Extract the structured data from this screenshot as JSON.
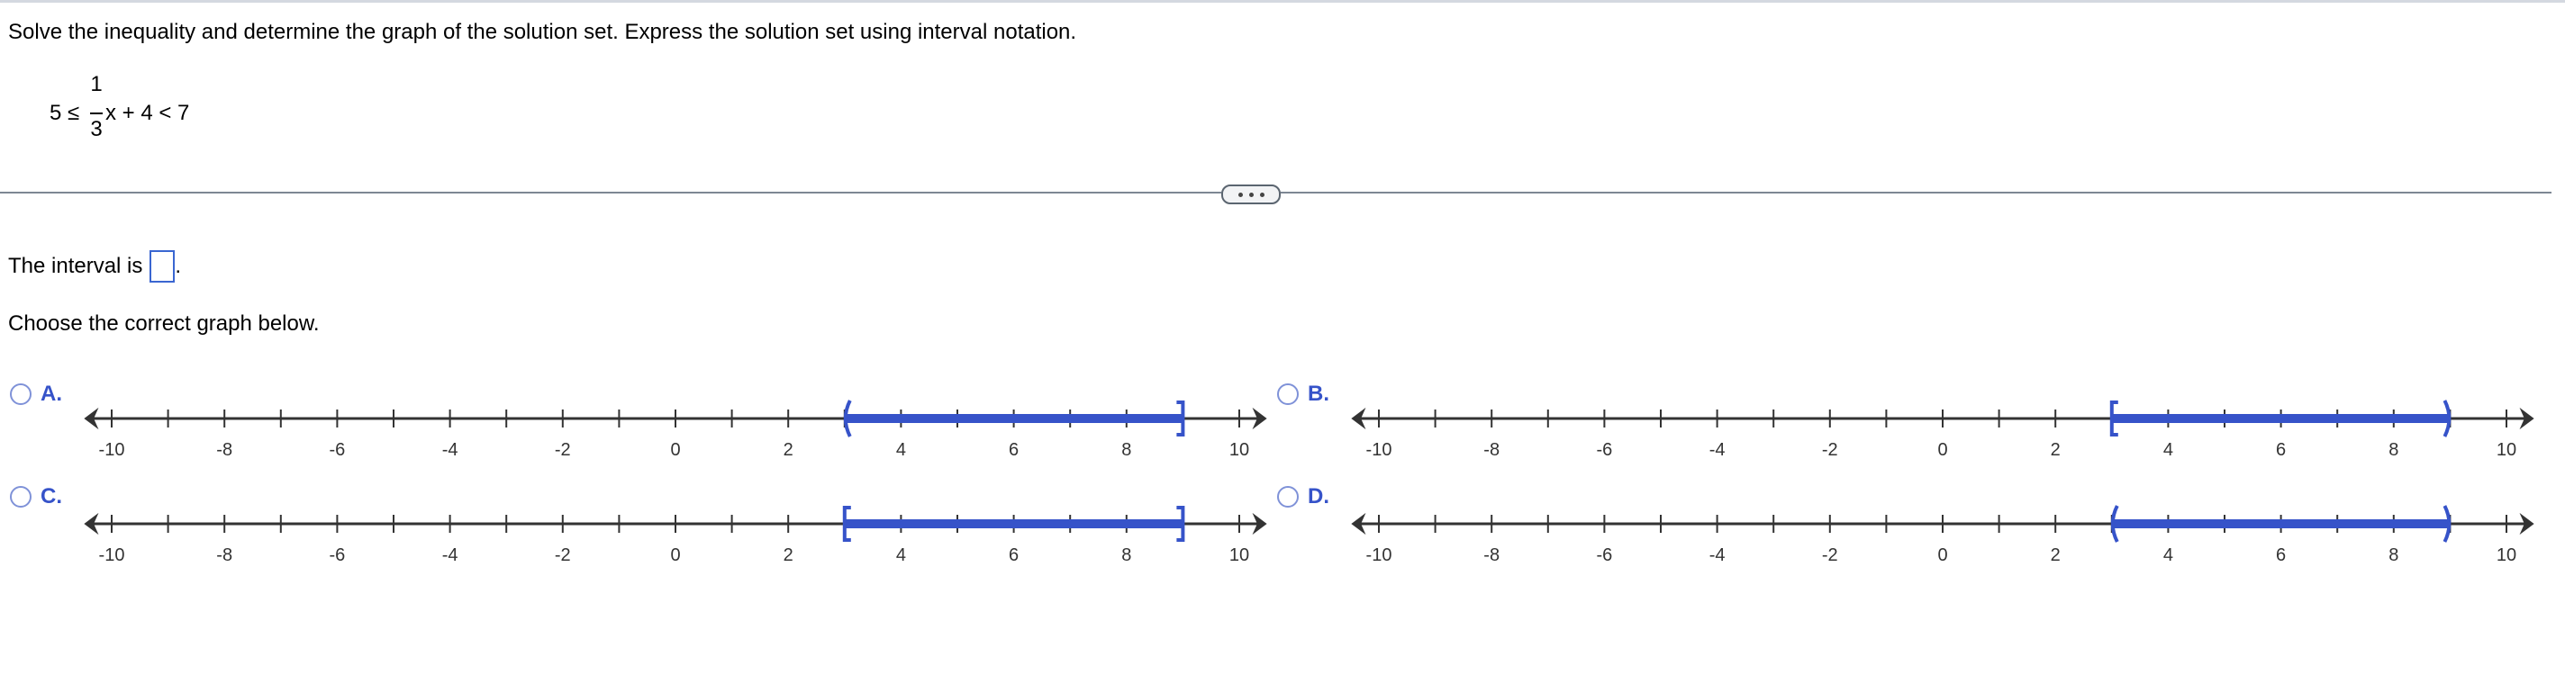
{
  "question": "Solve the inequality and determine the graph of the solution set. Express the solution set using interval notation.",
  "equation": {
    "left": "5 ≤ ",
    "numerator": "1",
    "denominator": "3",
    "right": "x + 4 < 7"
  },
  "interval_prompt": "The interval is",
  "interval_value": "",
  "interval_suffix": ".",
  "choose_prompt": "Choose the correct graph below.",
  "colors": {
    "accent": "#3653c9",
    "axis": "#333333"
  },
  "axis": {
    "min": -10,
    "max": 10,
    "labels": [
      "-10",
      "-8",
      "-6",
      "-4",
      "-2",
      "0",
      "2",
      "4",
      "6",
      "8",
      "10"
    ]
  },
  "options": [
    {
      "label": "A.",
      "interval": {
        "start": 3,
        "end": 9,
        "left": "open",
        "right": "closed"
      }
    },
    {
      "label": "B.",
      "interval": {
        "start": 3,
        "end": 9,
        "left": "closed",
        "right": "open"
      }
    },
    {
      "label": "C.",
      "interval": {
        "start": 3,
        "end": 9,
        "left": "closed",
        "right": "closed"
      }
    },
    {
      "label": "D.",
      "interval": {
        "start": 3,
        "end": 9,
        "left": "open",
        "right": "open"
      }
    }
  ]
}
